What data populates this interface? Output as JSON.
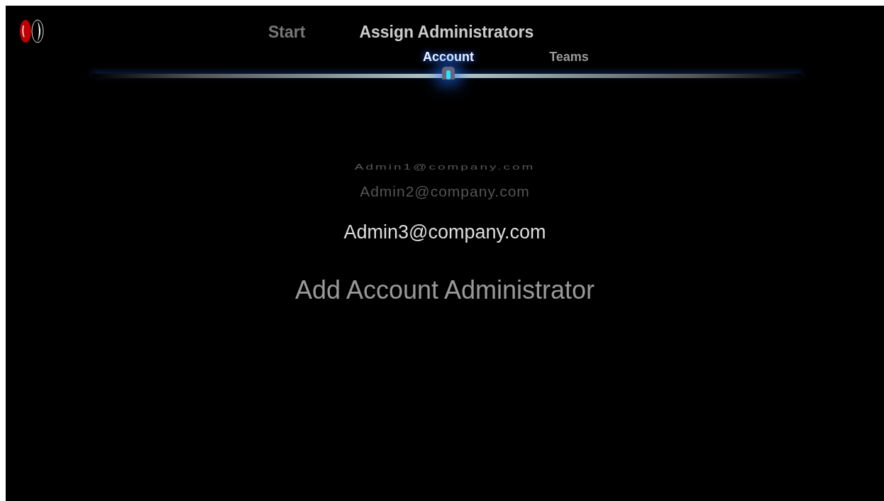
{
  "breadcrumb": [
    {
      "label": "Start",
      "selected": false
    },
    {
      "label": "Assign Administrators",
      "selected": true
    }
  ],
  "steps": [
    {
      "label": "Account",
      "selected": true
    },
    {
      "label": "Teams",
      "selected": false
    }
  ],
  "admins": [
    {
      "email": "Admin1@company.com",
      "kind": "far"
    },
    {
      "email": "Admin2@company.com",
      "kind": "near"
    },
    {
      "email": "Admin3@company.com",
      "kind": "current"
    }
  ],
  "add_field": {
    "placeholder": "Add Account Administrator"
  }
}
